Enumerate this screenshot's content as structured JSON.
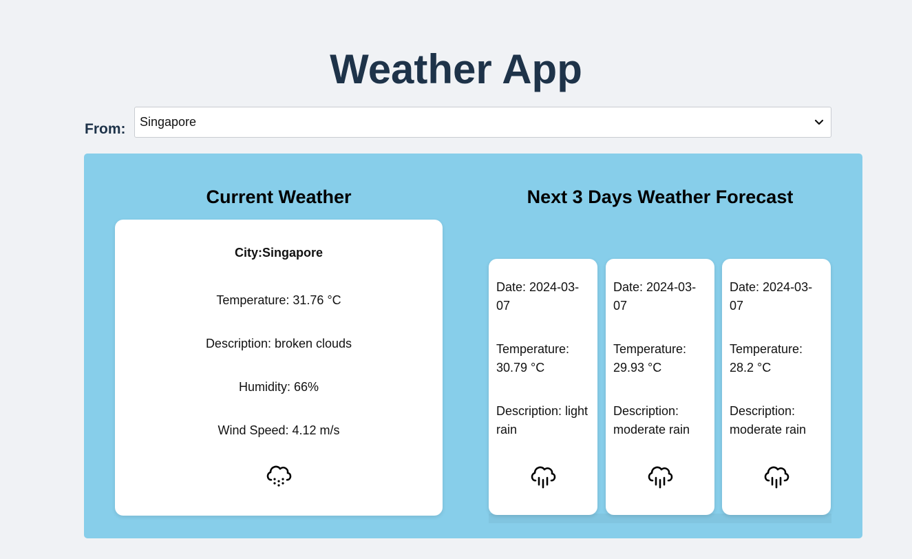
{
  "app": {
    "title": "Weather App"
  },
  "selector": {
    "label": "From:",
    "value": "Singapore",
    "options": [
      "Singapore"
    ]
  },
  "current": {
    "heading": "Current Weather",
    "city": "City:Singapore",
    "temperature": "Temperature: 31.76 °C",
    "description": "Description: broken clouds",
    "humidity": "Humidity: 66%",
    "wind": "Wind Speed: 4.12 m/s",
    "icon": "cloud-drizzle-icon"
  },
  "forecast": {
    "heading": "Next 3 Days Weather Forecast",
    "days": [
      {
        "date": "Date: 2024-03-07",
        "temperature": "Temperature: 30.79 °C",
        "description": "Description: light rain",
        "icon": "cloud-rain-icon"
      },
      {
        "date": "Date: 2024-03-07",
        "temperature": "Temperature: 29.93 °C",
        "description": "Description: moderate rain",
        "icon": "cloud-rain-icon"
      },
      {
        "date": "Date: 2024-03-07",
        "temperature": "Temperature: 28.2 °C",
        "description": "Description: moderate rain",
        "icon": "cloud-rain-icon"
      }
    ]
  }
}
